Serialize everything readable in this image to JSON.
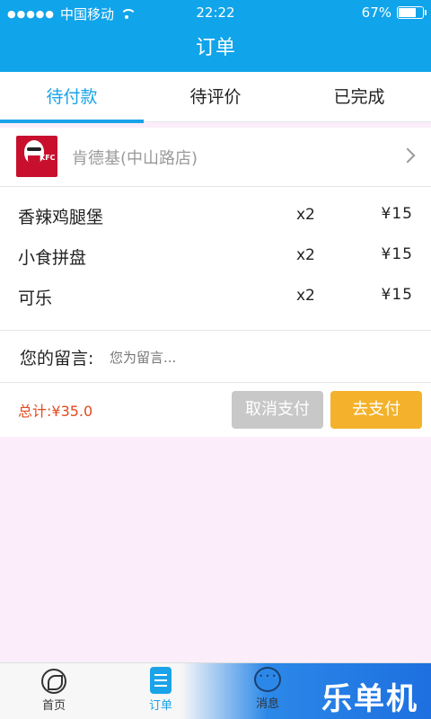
{
  "status_bar": {
    "carrier": "中国移动",
    "time": "22:22",
    "battery": "67%",
    "battery_level": 0.67
  },
  "nav": {
    "title": "订单"
  },
  "tabs": [
    {
      "label": "待付款",
      "active": true
    },
    {
      "label": "待评价",
      "active": false
    },
    {
      "label": "已完成",
      "active": false
    }
  ],
  "order": {
    "store_name": "肯德基(中山路店)",
    "store_logo_text": "KFC",
    "items": [
      {
        "name": "香辣鸡腿堡",
        "qty": "x2",
        "price": "¥15"
      },
      {
        "name": "小食拼盘",
        "qty": "x2",
        "price": "¥15"
      },
      {
        "name": "可乐",
        "qty": "x2",
        "price": "¥15"
      }
    ],
    "message_label": "您的留言:",
    "message_placeholder": "您为留言...",
    "total": "总计:¥35.0",
    "cancel_label": "取消支付",
    "pay_label": "去支付"
  },
  "bottom_nav": [
    {
      "label": "首页",
      "icon": "home-icon"
    },
    {
      "label": "订单",
      "icon": "order-icon",
      "active": true
    },
    {
      "label": "消息",
      "icon": "message-icon"
    }
  ],
  "brand_watermark": "乐单机",
  "colors": {
    "primary": "#10a4ea",
    "accent_price": "#e24a1f",
    "pay_button": "#f4b22c",
    "cancel_button": "#c8c8c8"
  }
}
